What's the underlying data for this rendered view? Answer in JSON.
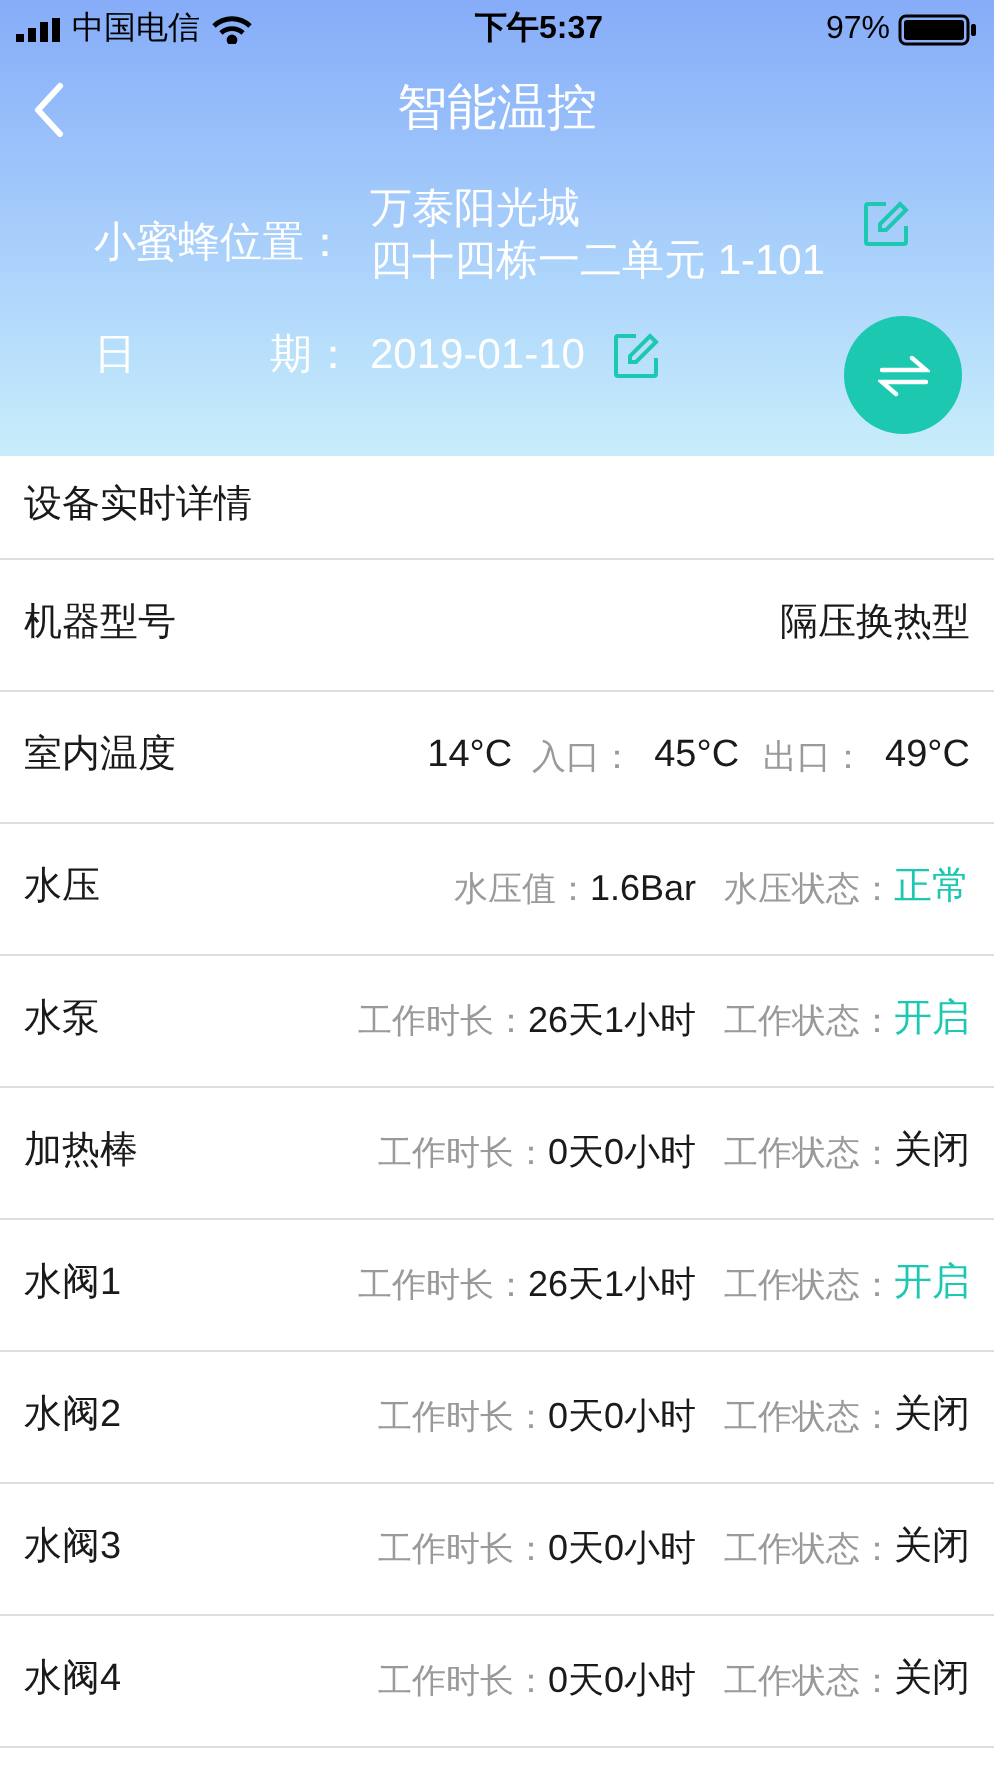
{
  "status_bar": {
    "carrier": "中国电信",
    "time": "下午5:37",
    "battery": "97%"
  },
  "header": {
    "title": "智能温控",
    "location_label": "小蜜蜂位置：",
    "location_lines": [
      "万泰阳光城",
      "四十四栋一二单元 1-101"
    ],
    "date_label_start": "日",
    "date_label_end": "期：",
    "date": "2019-01-10"
  },
  "section_title": "设备实时详情",
  "rows": [
    {
      "kind": "text",
      "name": "机器型号",
      "value": "隔压换热型"
    },
    {
      "kind": "temps",
      "name": "室内温度",
      "indoor": "14°C",
      "inlet_label": "入口：",
      "inlet": "45°C",
      "outlet_label": "出口：",
      "outlet": "49°C"
    },
    {
      "kind": "pair",
      "name": "水压",
      "value_label": "水压值：",
      "value": "1.6Bar",
      "status_label": "水压状态：",
      "status": "正常",
      "on": true
    },
    {
      "kind": "pair",
      "name": "水泵",
      "value_label": "工作时长：",
      "value": "26天1小时",
      "status_label": "工作状态：",
      "status": "开启",
      "on": true
    },
    {
      "kind": "pair",
      "name": "加热棒",
      "value_label": "工作时长：",
      "value": "0天0小时",
      "status_label": "工作状态：",
      "status": "关闭",
      "on": false
    },
    {
      "kind": "pair",
      "name": "水阀1",
      "value_label": "工作时长：",
      "value": "26天1小时",
      "status_label": "工作状态：",
      "status": "开启",
      "on": true
    },
    {
      "kind": "pair",
      "name": "水阀2",
      "value_label": "工作时长：",
      "value": "0天0小时",
      "status_label": "工作状态：",
      "status": "关闭",
      "on": false
    },
    {
      "kind": "pair",
      "name": "水阀3",
      "value_label": "工作时长：",
      "value": "0天0小时",
      "status_label": "工作状态：",
      "status": "关闭",
      "on": false
    },
    {
      "kind": "pair",
      "name": "水阀4",
      "value_label": "工作时长：",
      "value": "0天0小时",
      "status_label": "工作状态：",
      "status": "关闭",
      "on": false
    }
  ]
}
